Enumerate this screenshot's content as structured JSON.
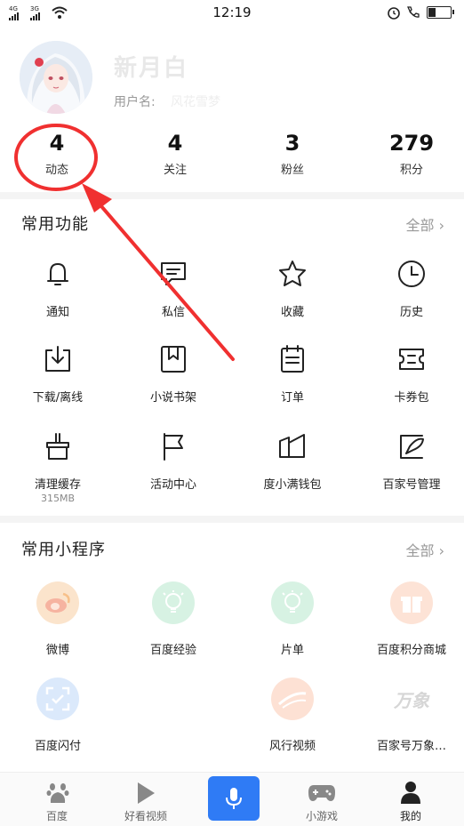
{
  "status_bar": {
    "time": "12:19",
    "sim1": "4G",
    "sim2": "3G"
  },
  "profile": {
    "username": "新月白",
    "userid_label": "用户名:",
    "userid_value": "风花雪梦"
  },
  "stats": [
    {
      "value": "4",
      "label": "动态"
    },
    {
      "value": "4",
      "label": "关注"
    },
    {
      "value": "3",
      "label": "粉丝"
    },
    {
      "value": "279",
      "label": "积分"
    }
  ],
  "common_functions": {
    "title": "常用功能",
    "all_label": "全部",
    "items": [
      {
        "label": "通知",
        "icon": "bell-icon"
      },
      {
        "label": "私信",
        "icon": "message-icon"
      },
      {
        "label": "收藏",
        "icon": "star-icon"
      },
      {
        "label": "历史",
        "icon": "clock-icon"
      },
      {
        "label": "下载/离线",
        "icon": "download-icon"
      },
      {
        "label": "小说书架",
        "icon": "bookmark-icon"
      },
      {
        "label": "订单",
        "icon": "calendar-icon"
      },
      {
        "label": "卡券包",
        "icon": "ticket-icon"
      },
      {
        "label": "清理缓存",
        "sub": "315MB",
        "icon": "broom-icon"
      },
      {
        "label": "活动中心",
        "icon": "flag-icon"
      },
      {
        "label": "度小满钱包",
        "icon": "wallet-icon"
      },
      {
        "label": "百家号管理",
        "icon": "edit-icon"
      }
    ]
  },
  "mini_programs": {
    "title": "常用小程序",
    "all_label": "全部",
    "items": [
      {
        "label": "微博",
        "icon": "weibo-icon",
        "color": "#fbe4cc"
      },
      {
        "label": "百度经验",
        "icon": "lightbulb-icon",
        "color": "#d7f2e3"
      },
      {
        "label": "片单",
        "icon": "lightbulb-icon",
        "color": "#d7f2e3"
      },
      {
        "label": "百度积分商城",
        "icon": "gift-icon",
        "color": "#fde3d6"
      },
      {
        "label": "百度闪付",
        "icon": "scan-icon",
        "color": "#dbe9fb"
      },
      {
        "label": "风行视频",
        "icon": "wind-icon",
        "color": "#fde1d4"
      },
      {
        "label": "百家号万象…",
        "icon": "wanxiang-icon",
        "color": "#ffffff",
        "logo_text": "万象"
      }
    ]
  },
  "tabbar": {
    "items": [
      {
        "label": "百度",
        "icon": "baidu-paw-icon"
      },
      {
        "label": "好看视频",
        "icon": "play-icon"
      },
      {
        "label": "",
        "icon": "microphone-icon"
      },
      {
        "label": "小游戏",
        "icon": "gamepad-icon"
      },
      {
        "label": "我的",
        "icon": "user-icon"
      }
    ]
  },
  "colors": {
    "accent_blue": "#2f7bf5",
    "annotation_red": "#f03030"
  }
}
